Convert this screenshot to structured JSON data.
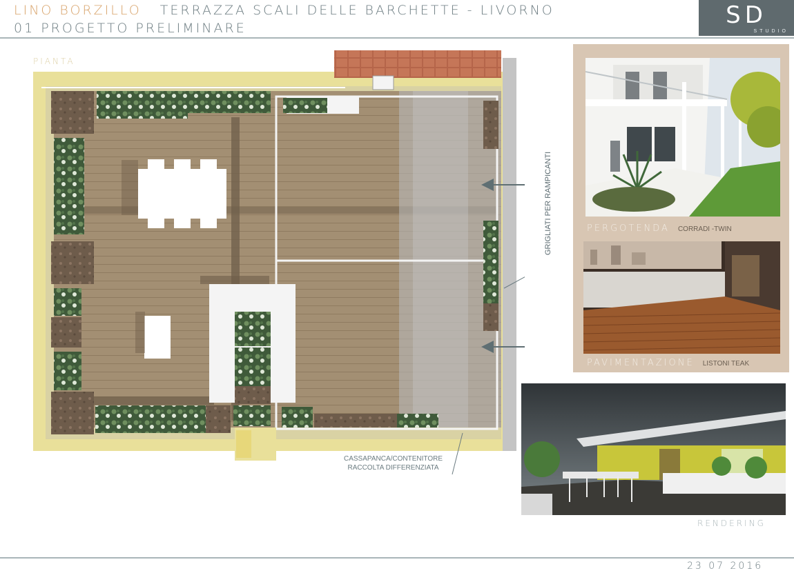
{
  "header": {
    "owner": "LINO BORZILLO",
    "project_place": "TERRAZZA SCALI DELLE BARCHETTE - LIVORNO",
    "subtitle": "01 PROGETTO PRELIMINARE",
    "logo_text": "SD",
    "logo_sub": "STUDIO"
  },
  "plan": {
    "label": "PIANTA",
    "annotation_climbers": "GRIGLIATI PER RAMPICANTI",
    "annotation_bench_line1": "CASSAPANCA/CONTENITORE",
    "annotation_bench_line2": "RACCOLTA DIFFERENZIATA"
  },
  "photos": [
    {
      "caption": "PERGOTENDA",
      "detail": "CORRADI -TWIN"
    },
    {
      "caption": "PAVIMENTAZIONE",
      "detail": "LISTONI TEAK"
    }
  ],
  "rendering": {
    "label": "RENDERING"
  },
  "footer": {
    "date": "23 07 2016"
  },
  "colors": {
    "deck": "#a38f73",
    "deck_line": "#8f7b60",
    "wall": "#e9e09a",
    "planter": "#6a5a4a",
    "accent_orange": "#d8a36a",
    "slate": "#6b7b80"
  }
}
